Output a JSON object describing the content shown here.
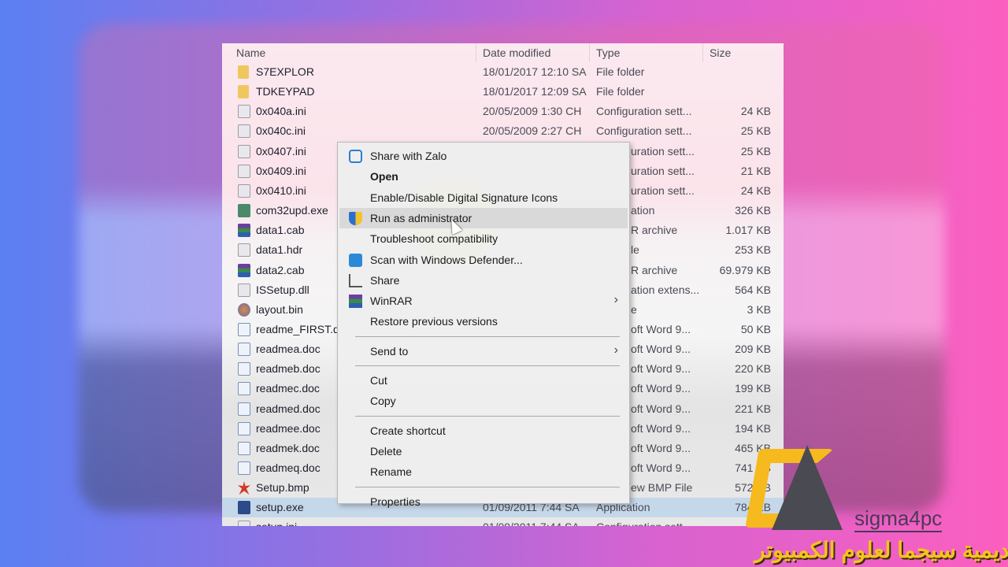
{
  "columns": {
    "name": "Name",
    "date": "Date modified",
    "type": "Type",
    "size": "Size"
  },
  "files": [
    {
      "icon": "folder",
      "name": "S7EXPLOR",
      "date": "18/01/2017 12:10 SA",
      "type": "File folder",
      "size": ""
    },
    {
      "icon": "folder",
      "name": "TDKEYPAD",
      "date": "18/01/2017 12:09 SA",
      "type": "File folder",
      "size": ""
    },
    {
      "icon": "ini",
      "name": "0x040a.ini",
      "date": "20/05/2009 1:30 CH",
      "type": "Configuration sett...",
      "size": "24 KB"
    },
    {
      "icon": "ini",
      "name": "0x040c.ini",
      "date": "20/05/2009 2:27 CH",
      "type": "Configuration sett...",
      "size": "25 KB"
    },
    {
      "icon": "ini",
      "name": "0x0407.ini",
      "date": "",
      "type_tail": "uration sett...",
      "size": "25 KB"
    },
    {
      "icon": "ini",
      "name": "0x0409.ini",
      "date": "",
      "type_tail": "uration sett...",
      "size": "21 KB"
    },
    {
      "icon": "ini",
      "name": "0x0410.ini",
      "date": "",
      "type_tail": "uration sett...",
      "size": "24 KB"
    },
    {
      "icon": "exe",
      "name": "com32upd.exe",
      "date": "",
      "type_tail": "ation",
      "size": "326 KB"
    },
    {
      "icon": "cab",
      "name": "data1.cab",
      "date": "",
      "type_tail": "R archive",
      "size": "1.017 KB"
    },
    {
      "icon": "ini",
      "name": "data1.hdr",
      "date": "",
      "type_tail": "le",
      "size": "253 KB"
    },
    {
      "icon": "cab",
      "name": "data2.cab",
      "date": "",
      "type_tail": "R archive",
      "size": "69.979 KB"
    },
    {
      "icon": "ini",
      "name": "ISSetup.dll",
      "date": "",
      "type_tail": "ation extens...",
      "size": "564 KB"
    },
    {
      "icon": "bin",
      "name": "layout.bin",
      "date": "",
      "type_tail": "e",
      "size": "3 KB"
    },
    {
      "icon": "doc",
      "name": "readme_FIRST.d",
      "date": "",
      "type_tail": "oft Word 9...",
      "size": "50 KB"
    },
    {
      "icon": "doc",
      "name": "readmea.doc",
      "date": "",
      "type_tail": "oft Word 9...",
      "size": "209 KB"
    },
    {
      "icon": "doc",
      "name": "readmeb.doc",
      "date": "",
      "type_tail": "oft Word 9...",
      "size": "220 KB"
    },
    {
      "icon": "doc",
      "name": "readmec.doc",
      "date": "",
      "type_tail": "oft Word 9...",
      "size": "199 KB"
    },
    {
      "icon": "doc",
      "name": "readmed.doc",
      "date": "",
      "type_tail": "oft Word 9...",
      "size": "221 KB"
    },
    {
      "icon": "doc",
      "name": "readmee.doc",
      "date": "",
      "type_tail": "oft Word 9...",
      "size": "194 KB"
    },
    {
      "icon": "doc",
      "name": "readmek.doc",
      "date": "",
      "type_tail": "oft Word 9...",
      "size": "465 KB"
    },
    {
      "icon": "doc",
      "name": "readmeq.doc",
      "date": "",
      "type_tail": "oft Word 9...",
      "size": "741 KB"
    },
    {
      "icon": "bmp",
      "name": "Setup.bmp",
      "date": "",
      "type_tail": "ew BMP File",
      "size": "572 KB"
    },
    {
      "icon": "setup",
      "name": "setup.exe",
      "date": "01/09/2011 7:44 SA",
      "type": "Application",
      "size": "784 KB",
      "selected": true
    },
    {
      "icon": "ini",
      "name": "setup.ini",
      "date": "01/09/2011 7:44 SA",
      "type": "Configuration sett...",
      "size": ""
    }
  ],
  "context_menu": [
    {
      "label": "Share with Zalo",
      "icon": "zalo-icon"
    },
    {
      "label": "Open",
      "bold": true
    },
    {
      "label": "Enable/Disable Digital Signature Icons"
    },
    {
      "label": "Run as administrator",
      "icon": "uac-shield-icon",
      "highlighted": true
    },
    {
      "label": "Troubleshoot compatibility"
    },
    {
      "label": "Scan with Windows Defender...",
      "icon": "windows-defender-icon"
    },
    {
      "label": "Share",
      "icon": "share-icon"
    },
    {
      "label": "WinRAR",
      "icon": "winrar-icon",
      "submenu": true
    },
    {
      "label": "Restore previous versions"
    },
    {
      "separator": true
    },
    {
      "label": "Send to",
      "submenu": true
    },
    {
      "separator": true
    },
    {
      "label": "Cut"
    },
    {
      "label": "Copy"
    },
    {
      "separator": true
    },
    {
      "label": "Create shortcut"
    },
    {
      "label": "Delete"
    },
    {
      "label": "Rename"
    },
    {
      "separator": true
    },
    {
      "label": "Properties"
    }
  ],
  "watermark": {
    "brand": "sigma4pc",
    "arabic": "اكاديمية سيجما لعلوم الكمبيوتر",
    "colors": {
      "gold": "#f6b91e",
      "gray": "#4a4a52"
    }
  },
  "colors": {
    "selection": "#c5d8ea",
    "menu_highlight": "#d9d9d9"
  }
}
